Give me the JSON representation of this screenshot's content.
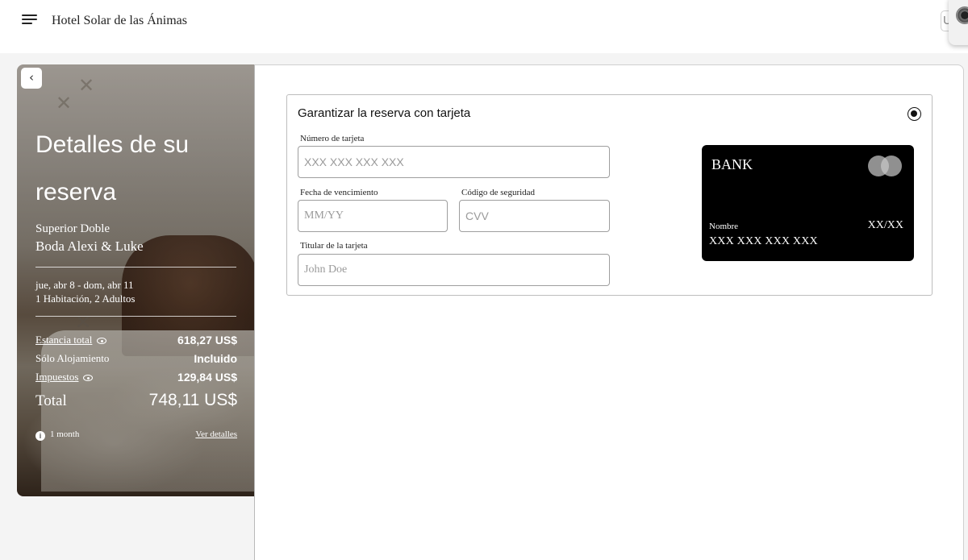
{
  "header": {
    "hotel_name": "Hotel Solar de las Ánimas",
    "user_initial": "U"
  },
  "summary": {
    "title": "Detalles de su reserva",
    "room_type": "Superior Doble",
    "event": "Boda Alexi & Luke",
    "dates": "jue, abr 8 - dom, abr 11",
    "guests": "1 Habitación, 2 Adultos",
    "rows": [
      {
        "label": "Estancia total",
        "value": "618,27 US$"
      },
      {
        "label": "Sólo Alojamiento",
        "value": "Incluido"
      },
      {
        "label": "Impuestos",
        "value": "129,84 US$"
      }
    ],
    "total_label": "Total",
    "total_value": "748,11 US$",
    "info_text": "1 month",
    "details_link": "Ver detalles",
    "icons": [
      "chevron-left-icon",
      "eye-icon",
      "info-icon"
    ]
  },
  "payment": {
    "title": "Garantizar la reserva con tarjeta",
    "card_number_label": "Número de tarjeta",
    "card_number_placeholder": "XXX XXX XXX XXX",
    "expiry_label": "Fecha de vencimiento",
    "expiry_placeholder": "MM/YY",
    "cvv_label": "Código de seguridad",
    "cvv_placeholder": "CVV",
    "holder_label": "Titular de la tarjeta",
    "holder_placeholder": "John Doe"
  },
  "card_preview": {
    "bank": "BANK",
    "name_label": "Nombre",
    "expiry": "XX/XX",
    "number": "XXX XXX XXX XXX"
  },
  "colors": {
    "page_bg": "#f4f4f4",
    "card_bg": "#000000",
    "accent": "#111111"
  }
}
